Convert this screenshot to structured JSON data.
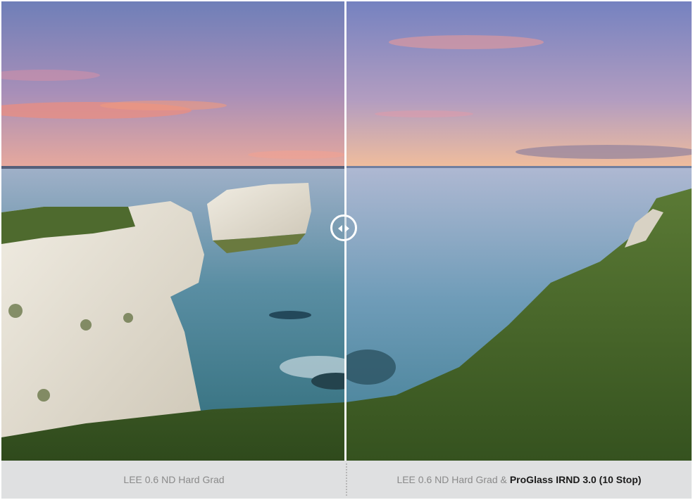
{
  "comparison": {
    "before": {
      "image_label": "cliffs-long-exposure-before",
      "caption": "LEE 0.6 ND Hard Grad"
    },
    "after": {
      "image_label": "cliffs-long-exposure-after",
      "caption_prefix": "LEE 0.6 ND Hard Grad &",
      "caption_emphasis": "ProGlass IRND 3.0 (10 Stop)"
    },
    "handle": {
      "icon": "left-right-arrows-icon"
    }
  },
  "colors": {
    "sky_top": "#6f7fb8",
    "sky_horizon": "#e8a99c",
    "sea": "#4d7d95",
    "chalk": "#e6e1d4",
    "grass": "#3e6526",
    "caption_bg": "#dfe0e1",
    "caption_text": "#8a8a8a"
  }
}
